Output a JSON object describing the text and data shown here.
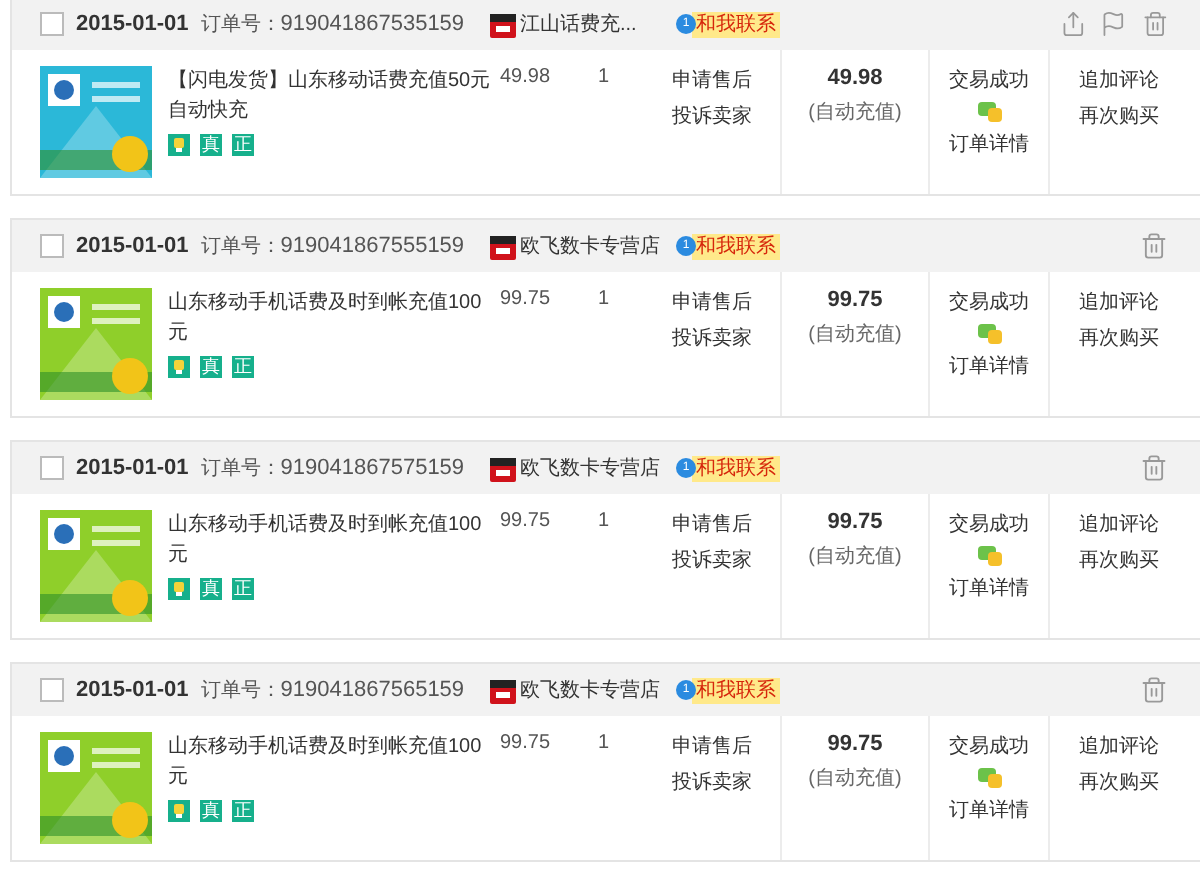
{
  "orders": [
    {
      "checked": false,
      "date": "2015-01-01",
      "order_label": "订单号：",
      "order_no": "919041867535159",
      "shop": "江山话费充...",
      "contact": "和我联系",
      "contact_count": "1",
      "share": true,
      "flag": true,
      "picture": {
        "kind": "picture",
        "color": "#2bb8d8"
      },
      "title": "【闪电发货】山东移动话费充值50元自动快充",
      "badges": [
        {
          "kind": "icon"
        },
        {
          "kind": "text",
          "label": "真"
        },
        {
          "kind": "text",
          "label": "正"
        }
      ],
      "price": "49.98",
      "qty": "1",
      "services": [
        "申请售后",
        "投诉卖家"
      ],
      "total": "49.98",
      "total_note": "(自动充值)",
      "status": "交易成功",
      "detail": "订单详情",
      "ops": [
        "追加评论",
        "再次购买"
      ]
    },
    {
      "checked": false,
      "date": "2015-01-01",
      "order_label": "订单号：",
      "order_no": "919041867555159",
      "shop": "欧飞数卡专营店",
      "contact": "和我联系",
      "contact_count": "1",
      "share": false,
      "flag": false,
      "picture": {
        "kind": "picture",
        "color": "#8fcf2a"
      },
      "title": "山东移动手机话费及时到帐充值100元",
      "badges": [
        {
          "kind": "icon"
        },
        {
          "kind": "text",
          "label": "真"
        },
        {
          "kind": "text",
          "label": "正"
        }
      ],
      "price": "99.75",
      "qty": "1",
      "services": [
        "申请售后",
        "投诉卖家"
      ],
      "total": "99.75",
      "total_note": "(自动充值)",
      "status": "交易成功",
      "detail": "订单详情",
      "ops": [
        "追加评论",
        "再次购买"
      ]
    },
    {
      "checked": false,
      "date": "2015-01-01",
      "order_label": "订单号：",
      "order_no": "919041867575159",
      "shop": "欧飞数卡专营店",
      "contact": "和我联系",
      "contact_count": "1",
      "share": false,
      "flag": false,
      "picture": {
        "kind": "picture",
        "color": "#8fcf2a"
      },
      "title": "山东移动手机话费及时到帐充值100元",
      "badges": [
        {
          "kind": "icon"
        },
        {
          "kind": "text",
          "label": "真"
        },
        {
          "kind": "text",
          "label": "正"
        }
      ],
      "price": "99.75",
      "qty": "1",
      "services": [
        "申请售后",
        "投诉卖家"
      ],
      "total": "99.75",
      "total_note": "(自动充值)",
      "status": "交易成功",
      "detail": "订单详情",
      "ops": [
        "追加评论",
        "再次购买"
      ]
    },
    {
      "checked": false,
      "date": "2015-01-01",
      "order_label": "订单号：",
      "order_no": "919041867565159",
      "shop": "欧飞数卡专营店",
      "contact": "和我联系",
      "contact_count": "1",
      "share": false,
      "flag": false,
      "picture": {
        "kind": "picture",
        "color": "#8fcf2a"
      },
      "title": "山东移动手机话费及时到帐充值100元",
      "badges": [
        {
          "kind": "icon"
        },
        {
          "kind": "text",
          "label": "真"
        },
        {
          "kind": "text",
          "label": "正"
        }
      ],
      "price": "99.75",
      "qty": "1",
      "services": [
        "申请售后",
        "投诉卖家"
      ],
      "total": "99.75",
      "total_note": "(自动充值)",
      "status": "交易成功",
      "detail": "订单详情",
      "ops": [
        "追加评论",
        "再次购买"
      ]
    }
  ]
}
